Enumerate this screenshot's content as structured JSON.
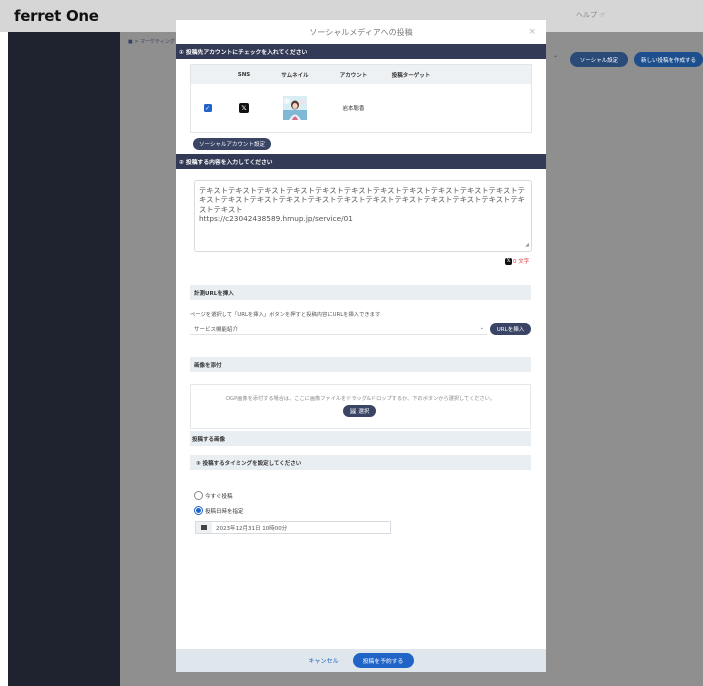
{
  "app": {
    "logo": "ferret One",
    "help": "ヘルプ ☞",
    "breadcrumb": "■ > マーケティング"
  },
  "background": {
    "btn_social_settings": "ソーシャル設定",
    "btn_new_post": "新しい投稿を作成する"
  },
  "modal": {
    "title": "ソーシャルメディアへの投稿",
    "close": "×",
    "section1": {
      "title": "① 投稿先アカウントにチェックを入れてください",
      "columns": [
        "SNS",
        "サムネイル",
        "アカウント",
        "投稿ターゲット"
      ],
      "row": {
        "checked": true,
        "sns_icon": "x-logo-icon",
        "account": "岩本聡香",
        "target": ""
      },
      "settings_button": "ソーシャルアカウント設定"
    },
    "section2": {
      "title": "② 投稿する内容を入力してください",
      "textarea_value": "テキストテキストテキストテキストテキストテキストテキストテキストテキストテキストテキストテキストテキストテキストテキストテキストテキストテキストテキストテキストテキストテキストテキストテキスト\nhttps://c23042438589.hmup.jp/service/01",
      "char_count": "0 文字",
      "url_insert": {
        "title": "計測URLを挿入",
        "hint": "ページを選択して「URLを挿入」ボタンを押すと投稿内容にURLを挿入できます",
        "selected_page": "サービス機能紹介",
        "button": "URLを挿入"
      },
      "image_attach": {
        "title": "画像を添付",
        "dropzone_text": "OGP画像を添付する場合は、ここに画像ファイルをドラッグ&ドロップするか、下のボタンから選択してください。",
        "select_button": "🖼 選択"
      },
      "posting_images_label": "投稿する画像"
    },
    "section3": {
      "title": "③ 投稿するタイミングを設定してください",
      "options": [
        "今すぐ投稿",
        "投稿日時を指定"
      ],
      "selected": "投稿日時を指定",
      "datetime": "2023年12月31日 10時00分"
    },
    "footer": {
      "cancel": "キャンセル",
      "submit": "投稿を予約する"
    }
  }
}
